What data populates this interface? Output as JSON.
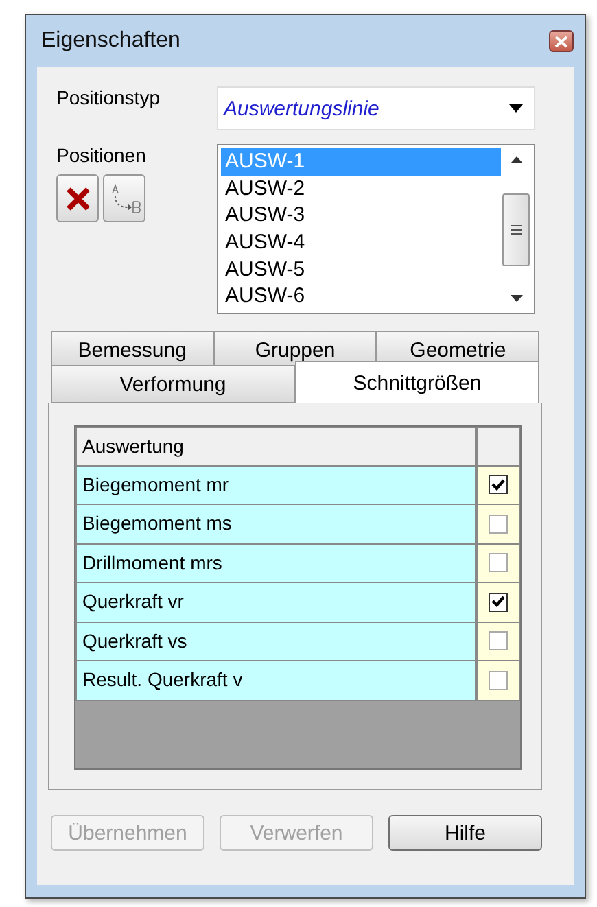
{
  "window": {
    "title": "Eigenschaften"
  },
  "positionstyp": {
    "label": "Positionstyp",
    "value": "Auswertungslinie"
  },
  "positionen": {
    "label": "Positionen",
    "items": [
      {
        "text": "AUSW-1",
        "selected": true
      },
      {
        "text": "AUSW-2",
        "selected": false
      },
      {
        "text": "AUSW-3",
        "selected": false
      },
      {
        "text": "AUSW-4",
        "selected": false
      },
      {
        "text": "AUSW-5",
        "selected": false
      },
      {
        "text": "AUSW-6",
        "selected": false
      }
    ]
  },
  "tab_rows": [
    {
      "tabs": [
        {
          "label": "Bemessung",
          "selected": false
        },
        {
          "label": "Gruppen",
          "selected": false
        },
        {
          "label": "Geometrie",
          "selected": false
        }
      ]
    },
    {
      "tabs": [
        {
          "label": "Verformung",
          "selected": false
        },
        {
          "label": "Schnittgrößen",
          "selected": true
        }
      ]
    }
  ],
  "table": {
    "columns": [
      "Auswertung"
    ],
    "rows": [
      {
        "name": "Biegemoment mr",
        "checked": true
      },
      {
        "name": "Biegemoment ms",
        "checked": false
      },
      {
        "name": "Drillmoment mrs",
        "checked": false
      },
      {
        "name": "Querkraft vr",
        "checked": true
      },
      {
        "name": "Querkraft vs",
        "checked": false
      },
      {
        "name": "Result. Querkraft v",
        "checked": false
      }
    ]
  },
  "buttons": [
    {
      "label": "Übernehmen",
      "disabled": true
    },
    {
      "label": "Verwerfen",
      "disabled": true
    },
    {
      "label": "Hilfe",
      "disabled": false
    }
  ]
}
